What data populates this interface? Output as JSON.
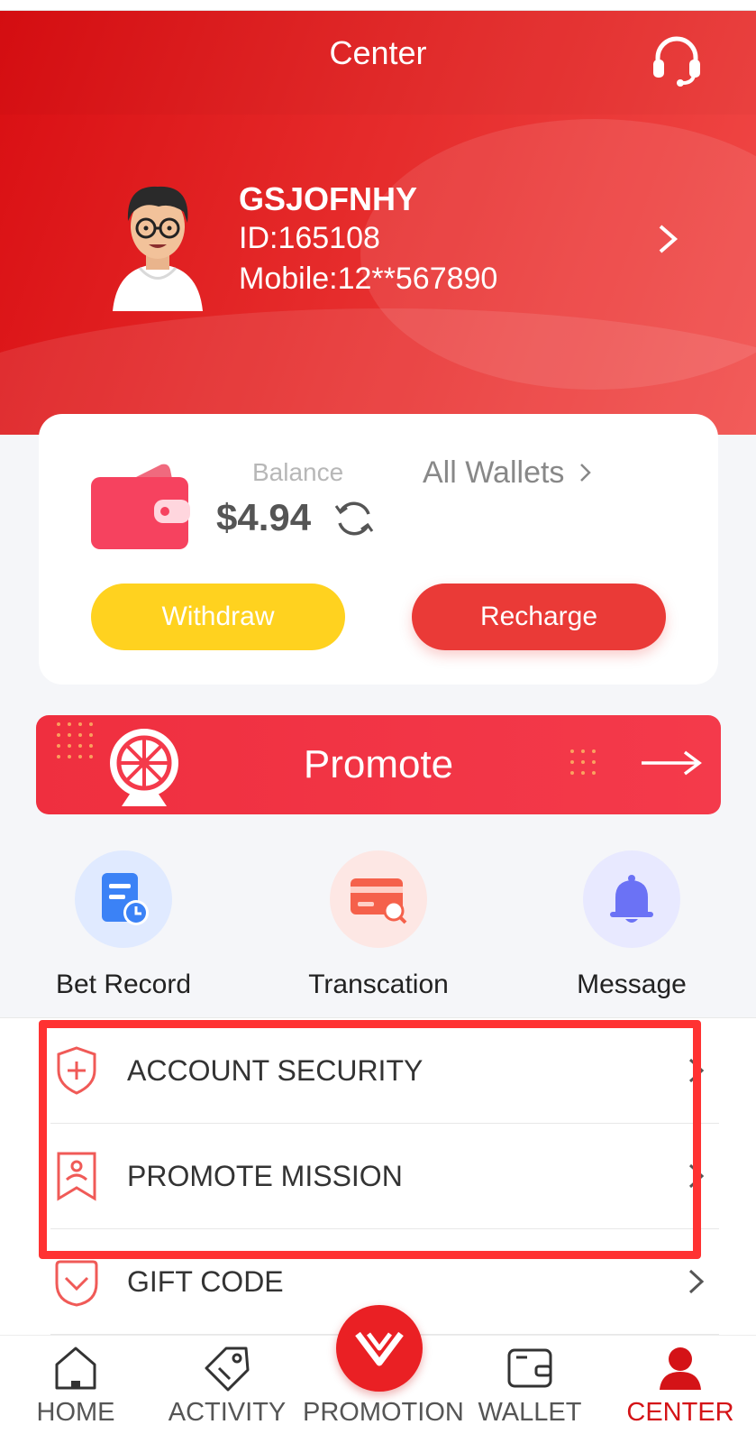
{
  "header": {
    "title": "Center"
  },
  "user": {
    "name": "GSJOFNHY",
    "id": "ID:165108",
    "mobile": "Mobile:12**567890"
  },
  "balance": {
    "label": "Balance",
    "value": "$4.94",
    "all_wallets": "All Wallets",
    "withdraw": "Withdraw",
    "recharge": "Recharge"
  },
  "promote": {
    "label": "Promote"
  },
  "quick_actions": [
    {
      "label": "Bet Record",
      "icon": "bet-record-icon"
    },
    {
      "label": "Transcation",
      "icon": "transaction-card-icon"
    },
    {
      "label": "Message",
      "icon": "bell-icon"
    }
  ],
  "menu": [
    {
      "label": "ACCOUNT SECURITY",
      "icon": "shield-plus-icon"
    },
    {
      "label": "PROMOTE MISSION",
      "icon": "mission-badge-icon"
    },
    {
      "label": "GIFT CODE",
      "icon": "gift-code-icon"
    }
  ],
  "nav": [
    {
      "label": "HOME",
      "icon": "home-icon"
    },
    {
      "label": "ACTIVITY",
      "icon": "tag-icon"
    },
    {
      "label": "PROMOTION",
      "icon": "promotion-logo-icon"
    },
    {
      "label": "WALLET",
      "icon": "wallet-icon"
    },
    {
      "label": "CENTER",
      "icon": "user-icon",
      "active": true
    }
  ],
  "colors": {
    "primary": "#e52a2a",
    "withdraw": "#ffd21f",
    "recharge": "#ea3a37",
    "active_nav": "#d41317",
    "highlight": "#ff3232"
  }
}
